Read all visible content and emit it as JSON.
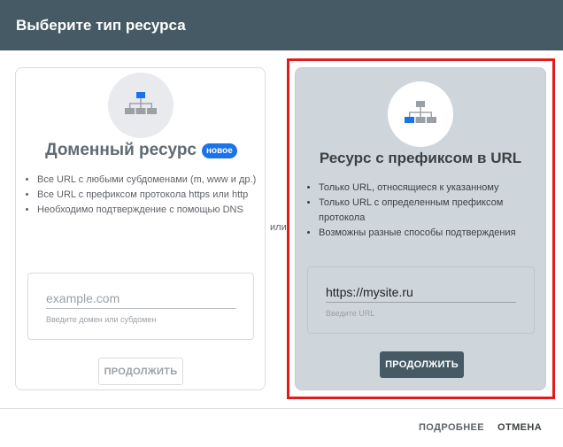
{
  "dialog": {
    "title": "Выберите тип ресурса"
  },
  "domain_card": {
    "icon": "sitemap-icon",
    "title": "Доменный ресурс",
    "badge": "новое",
    "features": [
      "Все URL с любыми субдоменами (m, www и др.)",
      "Все URL с префиксом протокола https или http",
      "Необходимо подтверждение с помощью DNS"
    ],
    "input_placeholder": "example.com",
    "input_hint": "Введите домен или субдомен",
    "button_label": "ПРОДОЛЖИТЬ"
  },
  "separator": {
    "text": "или"
  },
  "url_prefix_card": {
    "icon": "sitemap-icon",
    "title": "Ресурс с префиксом в URL",
    "features": [
      "Только URL, относящиеся к указанному",
      "Только URL с определенным префиксом протокола",
      "Возможны разные способы подтверждения"
    ],
    "input_value": "https://mysite.ru",
    "input_hint": "Введите URL",
    "button_label": "ПРОДОЛЖИТЬ"
  },
  "footer": {
    "more_label": "ПОДРОБНЕЕ",
    "cancel_label": "ОТМЕНА"
  },
  "colors": {
    "header_bg": "#455a64",
    "highlight_border": "#e21a1a",
    "badge_bg": "#1a73e8",
    "selected_card_bg": "#cfd6db"
  }
}
